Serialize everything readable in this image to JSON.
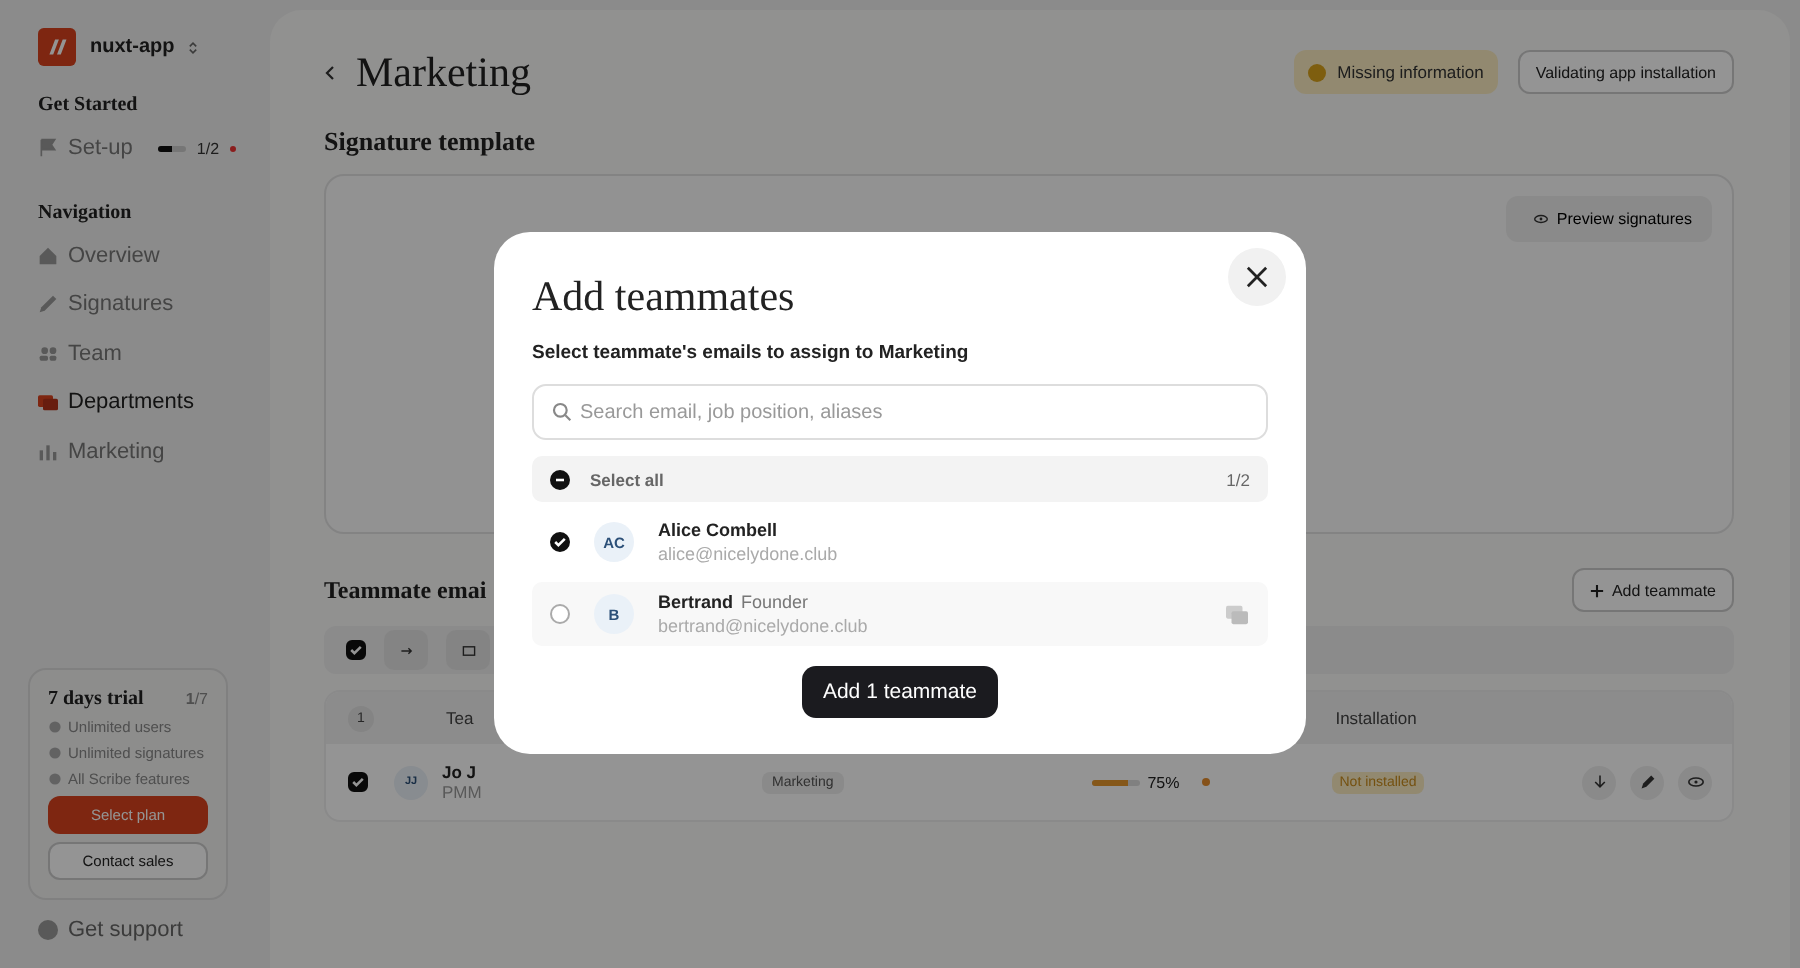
{
  "sidebar": {
    "workspace": "nuxt-app",
    "sections": [
      {
        "title": "Get Started",
        "items": [
          {
            "label": "Set-up",
            "selected": false,
            "level": 0.5,
            "progress": "1/2"
          }
        ]
      },
      {
        "title": "Navigation",
        "items": [
          {
            "label": "Overview",
            "selected": false
          },
          {
            "label": "Signatures",
            "selected": false
          },
          {
            "label": "Team",
            "selected": false
          },
          {
            "label": "Departments",
            "selected": true
          },
          {
            "label": "Marketing",
            "selected": false
          }
        ]
      }
    ],
    "trial": {
      "title": "7 days trial",
      "count": "**1**/7",
      "features": [
        "Unlimited users",
        "Unlimited signatures",
        "All Scribe features"
      ],
      "primary_button": "Select plan",
      "secondary_button": "Contact sales"
    },
    "support": "Get support"
  },
  "header": {
    "title": "Marketing",
    "status": "Missing information",
    "action": "Validating app installation"
  },
  "signature": {
    "title": "Signature template",
    "preview_button": "Preview signatures"
  },
  "teammates": {
    "title": "Teammate emai",
    "add_button": "Add teammate",
    "toolbar_checked": true,
    "count": "1",
    "columns": [
      "Tea",
      "Installation"
    ],
    "rows": [
      {
        "checked": true,
        "initials": "JJ",
        "name": "Jo J",
        "role": "PMM",
        "department": "Marketing",
        "level": 0.75,
        "percent": "75%",
        "installation": "Not installed"
      }
    ]
  },
  "modal": {
    "title": "Add teammates",
    "subtitle": "Select teammate's emails to assign to Marketing",
    "search": {
      "placeholder": "Search email, job position, aliases"
    },
    "select_all": {
      "label": "Select all",
      "indeterminate": true,
      "count": "1/2"
    },
    "people": [
      {
        "initials": "AC",
        "name": "Alice Combell",
        "email": "alice@nicelydone.club",
        "checked": true
      },
      {
        "initials": "B",
        "name": "Bertrand",
        "role": "Founder",
        "email": "bertrand@nicelydone.club",
        "checked": false
      }
    ],
    "submit": "Add 1 teammate"
  }
}
